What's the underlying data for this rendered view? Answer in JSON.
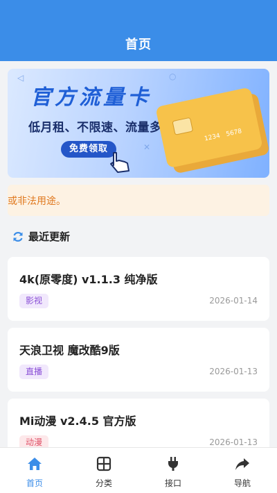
{
  "header": {
    "title": "首页"
  },
  "banner": {
    "headline": "官方流量卡",
    "subtitle": "低月租、不限速、流量多",
    "cta": "免费领取",
    "card_numbers": [
      "1234",
      "5678"
    ]
  },
  "notice": {
    "text": "或非法用途。"
  },
  "section": {
    "title": "最近更新"
  },
  "items": [
    {
      "name": "4k(原零度) v1.1.3 纯净版",
      "tag": "影视",
      "date": "2026-01-14"
    },
    {
      "name": "天浪卫视 魔改酷9版",
      "tag": "直播",
      "date": "2026-01-13"
    },
    {
      "name": "Mi动漫 v2.4.5 官方版",
      "tag": "动漫",
      "date": "2026-01-13"
    }
  ],
  "tabs": [
    {
      "label": "首页",
      "icon": "home-icon"
    },
    {
      "label": "分类",
      "icon": "grid-icon"
    },
    {
      "label": "接口",
      "icon": "plug-icon"
    },
    {
      "label": "导航",
      "icon": "share-icon"
    }
  ],
  "colors": {
    "accent": "#3b8de8",
    "notice_text": "#e0791f",
    "tag_movie": "#8a4fd6",
    "tag_live": "#8a4fd6",
    "tag_anime": "#e0556b"
  }
}
